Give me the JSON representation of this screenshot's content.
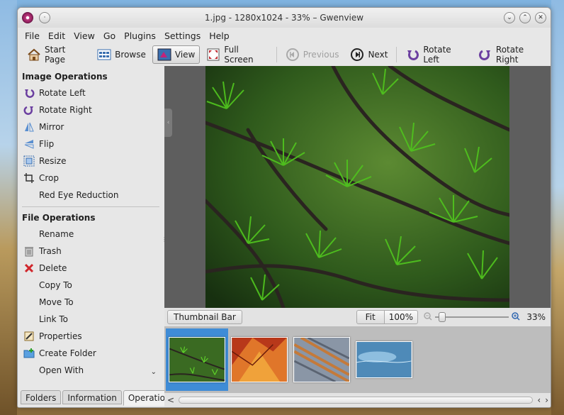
{
  "window": {
    "title": "1.jpg - 1280x1024 - 33% – Gwenview",
    "minimize_glyph": "⌄",
    "maximize_glyph": "⌃",
    "close_glyph": "✕",
    "sticky_glyph": "·"
  },
  "menu": {
    "file": "File",
    "edit": "Edit",
    "view": "View",
    "go": "Go",
    "plugins": "Plugins",
    "settings": "Settings",
    "help": "Help"
  },
  "toolbar": {
    "start_page": "Start Page",
    "browse": "Browse",
    "view": "View",
    "full_screen": "Full Screen",
    "previous": "Previous",
    "next": "Next",
    "rotate_left": "Rotate Left",
    "rotate_right": "Rotate Right"
  },
  "sidebar": {
    "image_ops_title": "Image Operations",
    "image_ops": [
      {
        "label": "Rotate Left",
        "icon": "rotate-left-icon"
      },
      {
        "label": "Rotate Right",
        "icon": "rotate-right-icon"
      },
      {
        "label": "Mirror",
        "icon": "mirror-icon"
      },
      {
        "label": "Flip",
        "icon": "flip-icon"
      },
      {
        "label": "Resize",
        "icon": "resize-icon"
      },
      {
        "label": "Crop",
        "icon": "crop-icon"
      },
      {
        "label": "Red Eye Reduction",
        "icon": ""
      }
    ],
    "file_ops_title": "File Operations",
    "file_ops": [
      {
        "label": "Rename",
        "icon": ""
      },
      {
        "label": "Trash",
        "icon": "trash-icon"
      },
      {
        "label": "Delete",
        "icon": "delete-icon"
      },
      {
        "label": "Copy To",
        "icon": ""
      },
      {
        "label": "Move To",
        "icon": ""
      },
      {
        "label": "Link To",
        "icon": ""
      },
      {
        "label": "Properties",
        "icon": "properties-icon"
      },
      {
        "label": "Create Folder",
        "icon": "create-folder-icon"
      },
      {
        "label": "Open With",
        "icon": ""
      }
    ],
    "scroll_down_glyph": "⌄",
    "tabs": {
      "folders": "Folders",
      "information": "Information",
      "operations": "Operations"
    }
  },
  "status": {
    "thumbnail_bar": "Thumbnail Bar",
    "fit": "Fit",
    "hundred": "100%",
    "zoom": "33%",
    "zoom_fraction": 0.05
  },
  "thumbnails": [
    {
      "name": "thumb-pine",
      "selected": true
    },
    {
      "name": "thumb-autumn-leaf",
      "selected": false
    },
    {
      "name": "thumb-rust",
      "selected": false
    },
    {
      "name": "thumb-blue",
      "selected": false
    }
  ],
  "hscroll": {
    "left_glyph": "‹",
    "right_glyph": "›",
    "start_glyph": "<"
  }
}
